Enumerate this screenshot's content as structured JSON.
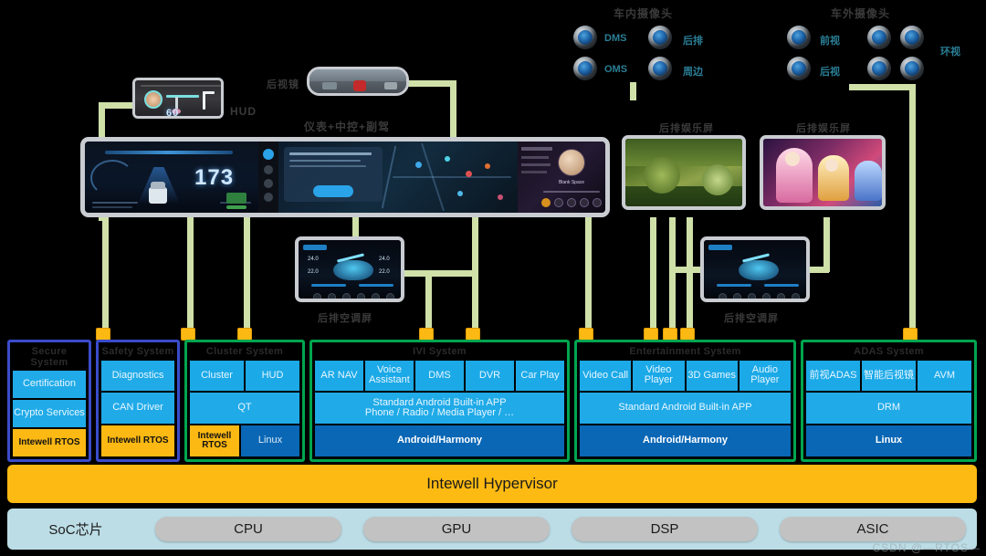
{
  "diagram": {
    "title_watermark": "CSDN @—RTOS—",
    "camera_groups": [
      {
        "name": "interior-cameras",
        "label": "车内摄像头",
        "items": [
          {
            "label": "DMS"
          },
          {
            "label": "后排"
          },
          {
            "label": "OMS"
          },
          {
            "label": "周边"
          }
        ]
      },
      {
        "name": "exterior-cameras",
        "label": "车外摄像头",
        "items": [
          {
            "label": "前视"
          },
          {
            "label": "后视"
          },
          {
            "label": "环视"
          }
        ]
      }
    ],
    "devices": [
      {
        "name": "hud-display",
        "label": "HUD"
      },
      {
        "name": "rear-view-mirror",
        "label": "后视镜"
      },
      {
        "name": "main-cockpit-display",
        "label": "仪表+中控+副驾"
      },
      {
        "name": "rear-entertainment-left",
        "label": "后排娱乐屏"
      },
      {
        "name": "rear-entertainment-right",
        "label": "后排娱乐屏"
      },
      {
        "name": "rear-ac-left",
        "label": "后排空调屏"
      },
      {
        "name": "rear-ac-right",
        "label": "后排空调屏"
      }
    ],
    "screen_text": {
      "cluster_speed": "173",
      "music_title": "Blank Space",
      "ac_temp_left": "24.0",
      "ac_temp_right": "24.0",
      "ac_temp_left2": "22.0",
      "ac_temp_right2": "22.0"
    },
    "systems": [
      {
        "name": "secure-system",
        "title": "Secure System",
        "border": "#3b4cca",
        "rows": [
          [
            {
              "text": "Certification",
              "style": "mid"
            }
          ],
          [
            {
              "text": "Crypto Services",
              "style": "mid"
            }
          ],
          [
            {
              "text": "Intewell RTOS",
              "style": "rtos"
            }
          ]
        ]
      },
      {
        "name": "safety-system",
        "title": "Safety System",
        "border": "#3b4cca",
        "rows": [
          [
            {
              "text": "Diagnostics",
              "style": "mid"
            }
          ],
          [
            {
              "text": "CAN Driver",
              "style": "mid"
            }
          ],
          [
            {
              "text": "Intewell RTOS",
              "style": "rtos"
            }
          ]
        ]
      },
      {
        "name": "cluster-system",
        "title": "Cluster System",
        "border": "#00a550",
        "rows": [
          [
            {
              "text": "Cluster",
              "style": "cell"
            },
            {
              "text": "HUD",
              "style": "cell"
            }
          ],
          [
            {
              "text": "QT",
              "style": "mid"
            }
          ],
          [
            {
              "text": "Intewell RTOS",
              "style": "rtos"
            },
            {
              "text": "Linux",
              "style": "linux"
            }
          ]
        ]
      },
      {
        "name": "ivi-system",
        "title": "IVI System",
        "border": "#00a550",
        "rows": [
          [
            {
              "text": "AR NAV",
              "style": "cell"
            },
            {
              "text": "Voice Assistant",
              "style": "cell"
            },
            {
              "text": "DMS",
              "style": "cell"
            },
            {
              "text": "DVR",
              "style": "cell"
            },
            {
              "text": "Car Play",
              "style": "cell"
            }
          ],
          [
            {
              "text": "Standard Android Built-in APP\nPhone / Radio / Media Player / …",
              "style": "mid"
            }
          ],
          [
            {
              "text": "Android/Harmony",
              "style": "os"
            }
          ]
        ]
      },
      {
        "name": "entertainment-system",
        "title": "Entertainment System",
        "border": "#00a550",
        "rows": [
          [
            {
              "text": "Video Call",
              "style": "cell"
            },
            {
              "text": "Video Player",
              "style": "cell"
            },
            {
              "text": "3D Games",
              "style": "cell"
            },
            {
              "text": "Audio Player",
              "style": "cell"
            }
          ],
          [
            {
              "text": "Standard Android Built-in APP",
              "style": "mid"
            }
          ],
          [
            {
              "text": "Android/Harmony",
              "style": "os"
            }
          ]
        ]
      },
      {
        "name": "adas-system",
        "title": "ADAS System",
        "border": "#00a550",
        "rows": [
          [
            {
              "text": "前视ADAS",
              "style": "cell"
            },
            {
              "text": "智能后视镜",
              "style": "cell"
            },
            {
              "text": "AVM",
              "style": "cell"
            }
          ],
          [
            {
              "text": "DRM",
              "style": "mid"
            }
          ],
          [
            {
              "text": "Linux",
              "style": "os"
            }
          ]
        ]
      }
    ],
    "hypervisor": {
      "label": "Intewell Hypervisor",
      "color": "#FDBA12"
    },
    "soc": {
      "label": "SoC芯片",
      "chips": [
        "CPU",
        "GPU",
        "DSP",
        "ASIC"
      ]
    }
  }
}
